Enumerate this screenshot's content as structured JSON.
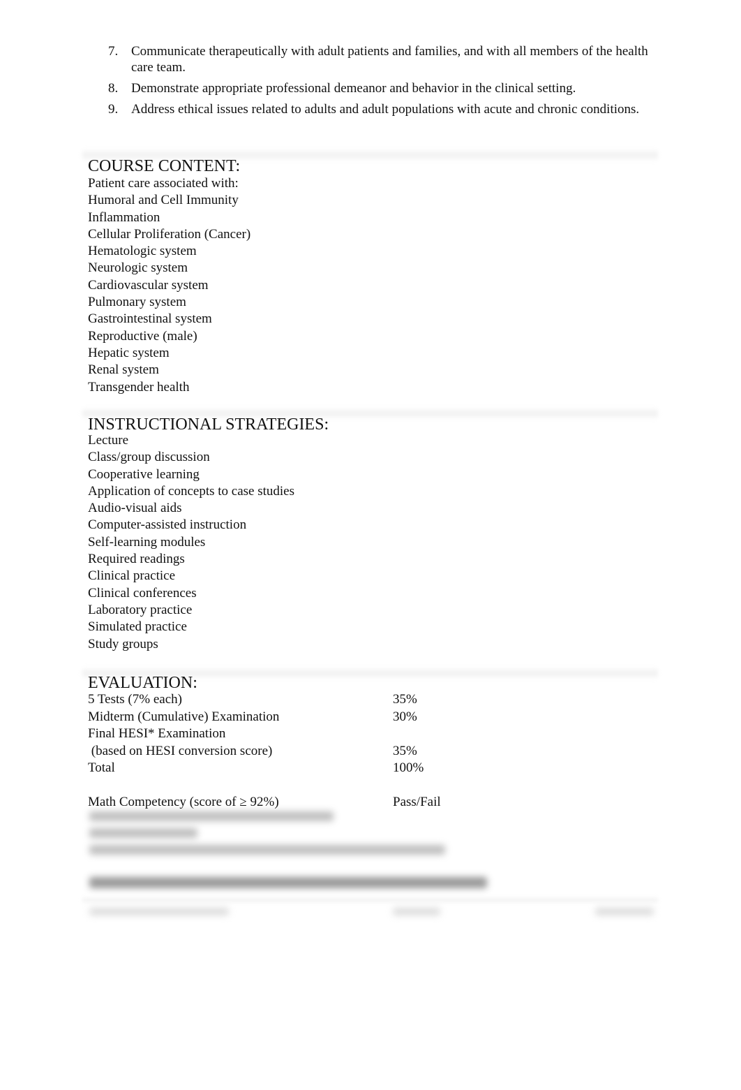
{
  "objectives": [
    {
      "num": "7.",
      "text": "Communicate therapeutically with adult patients and families, and with all members of the health care team."
    },
    {
      "num": "8.",
      "text": "Demonstrate appropriate professional demeanor and behavior in the clinical setting."
    },
    {
      "num": "9.",
      "text": "Address ethical issues related to adults and adult populations with acute and chronic conditions."
    }
  ],
  "course_content": {
    "heading": "COURSE CONTENT:",
    "items": [
      "Patient care associated with:",
      "Humoral and Cell Immunity",
      "Inflammation",
      "Cellular Proliferation (Cancer)",
      "Hematologic system",
      "Neurologic system",
      "Cardiovascular system",
      "Pulmonary system",
      "Gastrointestinal system",
      "Reproductive (male)",
      "Hepatic system",
      "Renal system",
      "Transgender health"
    ]
  },
  "instructional_strategies": {
    "heading": "INSTRUCTIONAL STRATEGIES:",
    "items": [
      "Lecture",
      "Class/group discussion",
      "Cooperative learning",
      "Application of concepts to case studies",
      "Audio-visual aids",
      "Computer-assisted instruction",
      "Self-learning modules",
      "Required readings",
      "Clinical practice",
      "Clinical conferences",
      "Laboratory practice",
      "Simulated practice",
      "Study groups"
    ]
  },
  "evaluation": {
    "heading": "EVALUATION:",
    "rows": [
      {
        "label": "5 Tests (7% each)",
        "value": "35%"
      },
      {
        "label": "Midterm (Cumulative) Examination",
        "value": "30%"
      },
      {
        "label": "Final HESI* Examination",
        "value": ""
      },
      {
        "label": " (based on HESI conversion score)",
        "value": "35%"
      },
      {
        "label": "Total",
        "value": "100%"
      },
      {
        "label": "",
        "value": ""
      },
      {
        "label": "Math Competency (score of ≥ 92%)",
        "value": "Pass/Fail"
      }
    ]
  }
}
